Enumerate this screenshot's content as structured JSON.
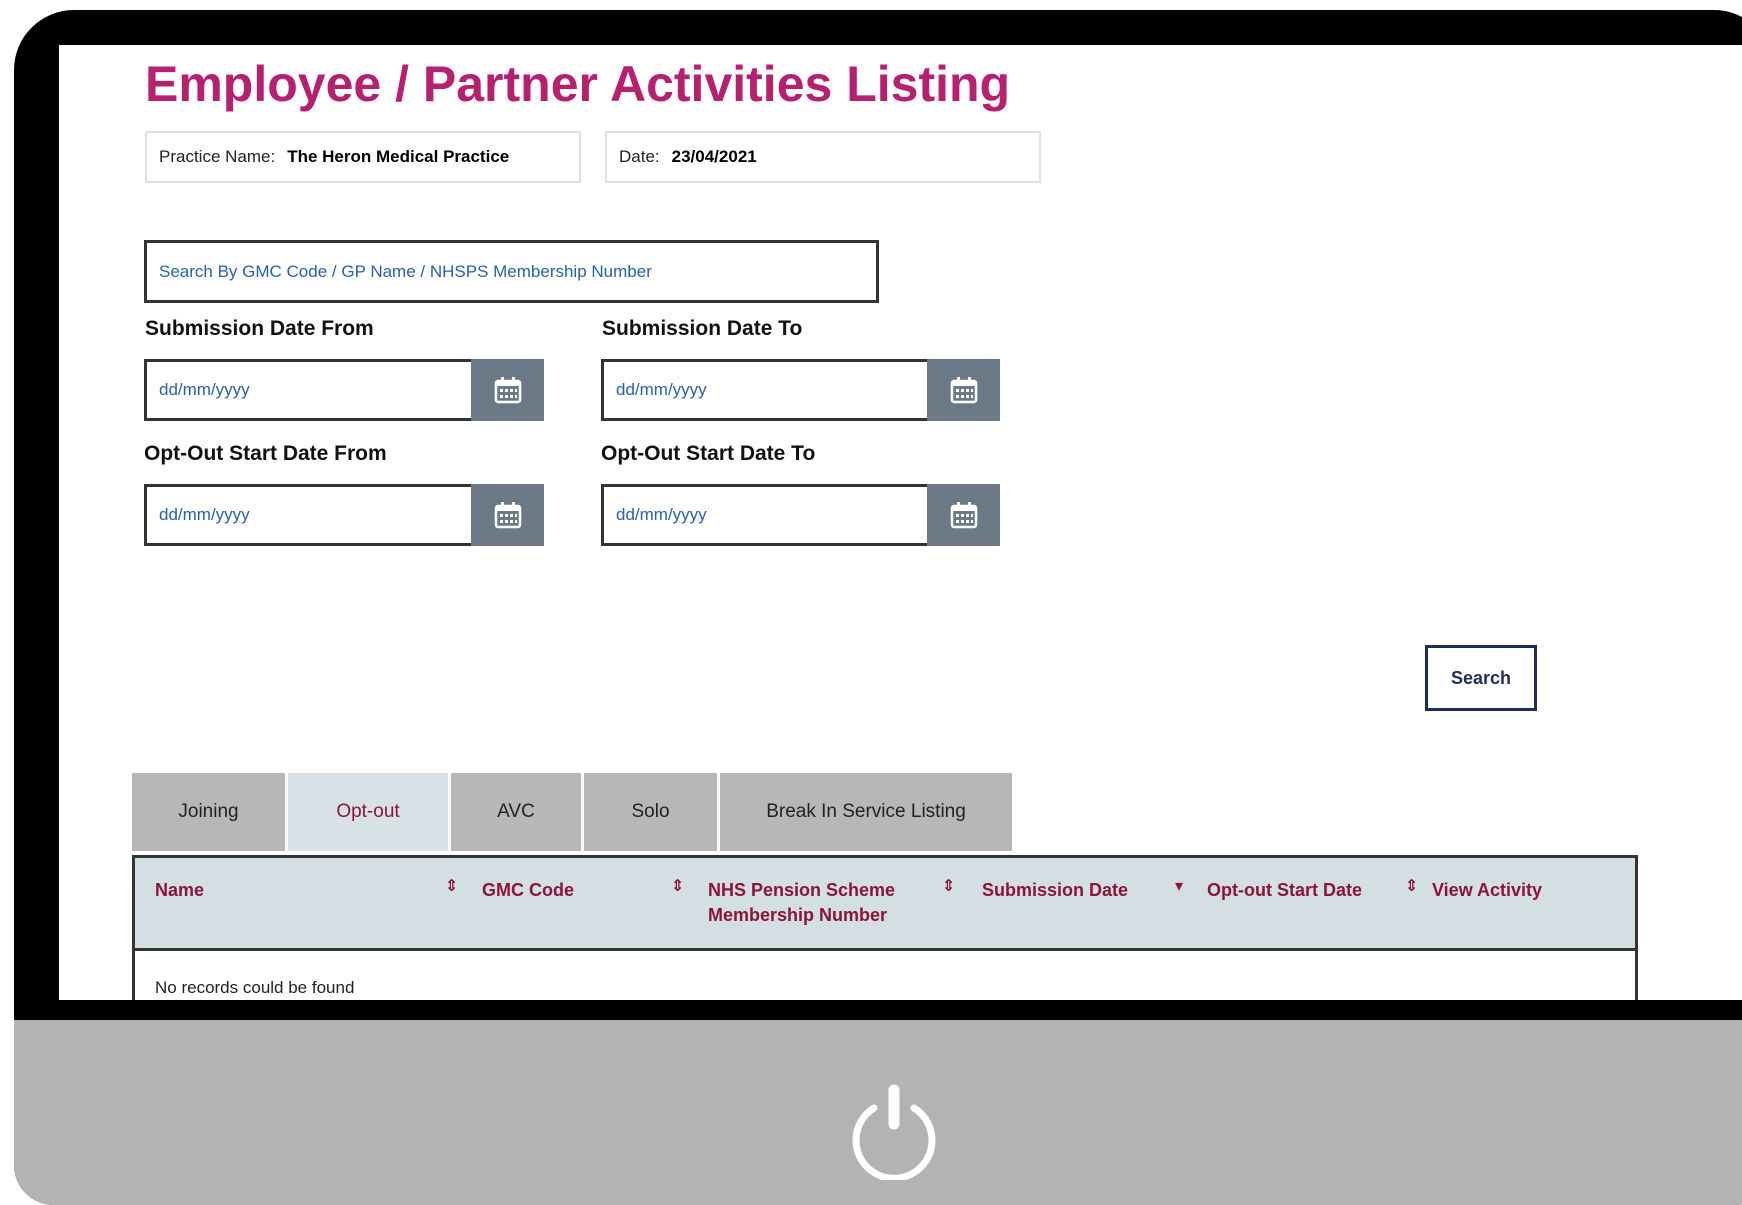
{
  "page": {
    "title": "Employee / Partner Activities Listing"
  },
  "info": {
    "practice_label": "Practice Name:",
    "practice_value": "The Heron Medical Practice",
    "date_label": "Date:",
    "date_value": "23/04/2021"
  },
  "search": {
    "placeholder": "Search By GMC Code / GP Name / NHSPS Membership Number",
    "button_label": "Search"
  },
  "filters": {
    "submission_from_label": "Submission Date From",
    "submission_to_label": "Submission Date To",
    "optout_from_label": "Opt-Out Start Date From",
    "optout_to_label": "Opt-Out Start Date To",
    "date_placeholder": "dd/mm/yyyy"
  },
  "tabs": [
    {
      "label": "Joining"
    },
    {
      "label": "Opt-out"
    },
    {
      "label": "AVC"
    },
    {
      "label": "Solo"
    },
    {
      "label": "Break In Service Listing"
    }
  ],
  "active_tab": "Opt-out",
  "table": {
    "columns": [
      {
        "label": "Name",
        "sort": "⇕"
      },
      {
        "label": "GMC Code",
        "sort": "⇕"
      },
      {
        "label": "NHS Pension Scheme Membership Number",
        "sort": "⇕"
      },
      {
        "label": "Submission Date",
        "sort": "▾"
      },
      {
        "label": "Opt-out Start Date",
        "sort": "⇕"
      },
      {
        "label": "View Activity"
      }
    ],
    "empty_message": "No records could be found"
  },
  "colors": {
    "title": "#b5206f",
    "header_text": "#8a1538",
    "calendar_button": "#6b7a86",
    "monitor_chin": "#b3b3b3"
  },
  "icons": {
    "calendar": "calendar-icon",
    "power": "power-icon"
  }
}
